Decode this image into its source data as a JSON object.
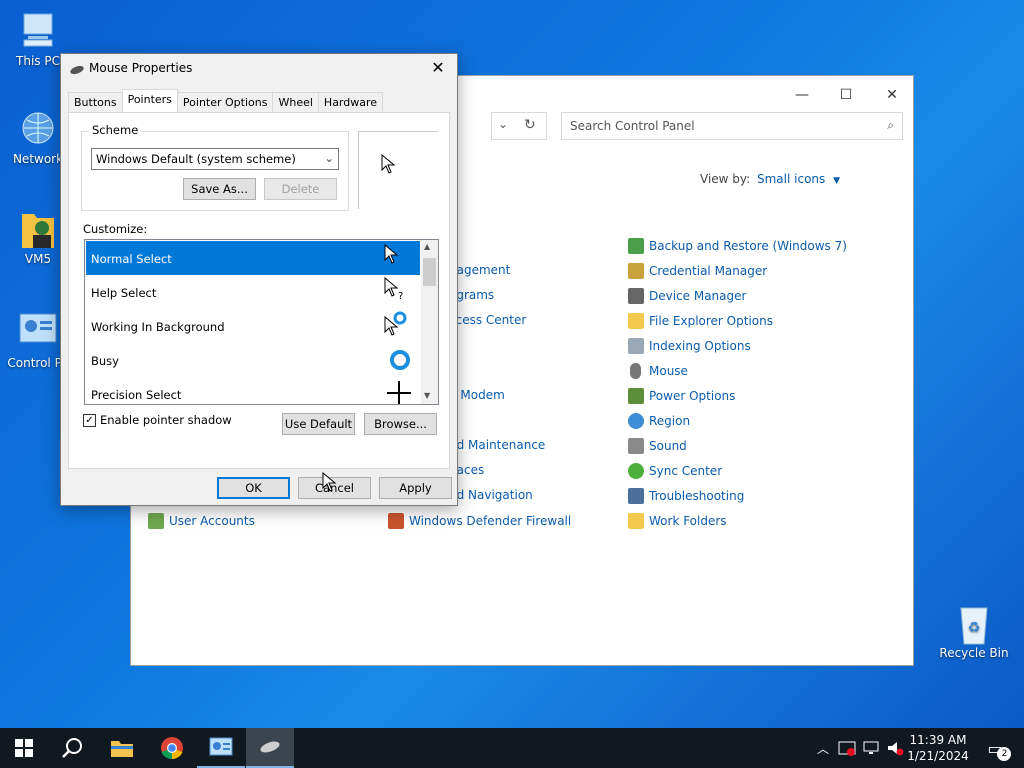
{
  "desktop": {
    "icons": [
      {
        "label": "This PC",
        "icon": "computer-icon"
      },
      {
        "label": "Network",
        "icon": "network-icon"
      },
      {
        "label": "VM5",
        "icon": "user-folder-icon"
      },
      {
        "label": "Control Pa",
        "icon": "control-panel-icon"
      },
      {
        "label": "Recycle Bin",
        "icon": "recycle-bin-icon"
      }
    ]
  },
  "control_panel": {
    "search_placeholder": "Search Control Panel",
    "view_by_label": "View by:",
    "view_by_value": "Small icons",
    "items_col1": [
      {
        "label": "User Accounts"
      }
    ],
    "items_col2": [
      {
        "label": "nagement"
      },
      {
        "label": "ograms"
      },
      {
        "label": "ccess Center"
      },
      {
        "label": "d Modem"
      },
      {
        "label": "nd Maintenance"
      },
      {
        "label": "paces"
      },
      {
        "label": "nd Navigation"
      },
      {
        "label": "Windows Defender Firewall"
      }
    ],
    "items_col3": [
      {
        "label": "Backup and Restore (Windows 7)"
      },
      {
        "label": "Credential Manager"
      },
      {
        "label": "Device Manager"
      },
      {
        "label": "File Explorer Options"
      },
      {
        "label": "Indexing Options"
      },
      {
        "label": "Mouse"
      },
      {
        "label": "Power Options"
      },
      {
        "label": "Region"
      },
      {
        "label": "Sound"
      },
      {
        "label": "Sync Center"
      },
      {
        "label": "Troubleshooting"
      },
      {
        "label": "Work Folders"
      }
    ]
  },
  "dialog": {
    "title": "Mouse Properties",
    "tabs": [
      "Buttons",
      "Pointers",
      "Pointer Options",
      "Wheel",
      "Hardware"
    ],
    "active_tab": "Pointers",
    "scheme_label": "Scheme",
    "scheme_value": "Windows Default (system scheme)",
    "save_as_label": "Save As...",
    "delete_label": "Delete",
    "customize_label": "Customize:",
    "pointers": [
      {
        "label": "Normal Select",
        "selected": true
      },
      {
        "label": "Help Select",
        "selected": false
      },
      {
        "label": "Working In Background",
        "selected": false
      },
      {
        "label": "Busy",
        "selected": false
      },
      {
        "label": "Precision Select",
        "selected": false
      }
    ],
    "enable_shadow_label": "Enable pointer shadow",
    "enable_shadow_checked": true,
    "use_default_label": "Use Default",
    "browse_label": "Browse...",
    "ok_label": "OK",
    "cancel_label": "Cancel",
    "apply_label": "Apply"
  },
  "taskbar": {
    "time": "11:39 AM",
    "date": "1/21/2024",
    "notifications_count": "2"
  }
}
